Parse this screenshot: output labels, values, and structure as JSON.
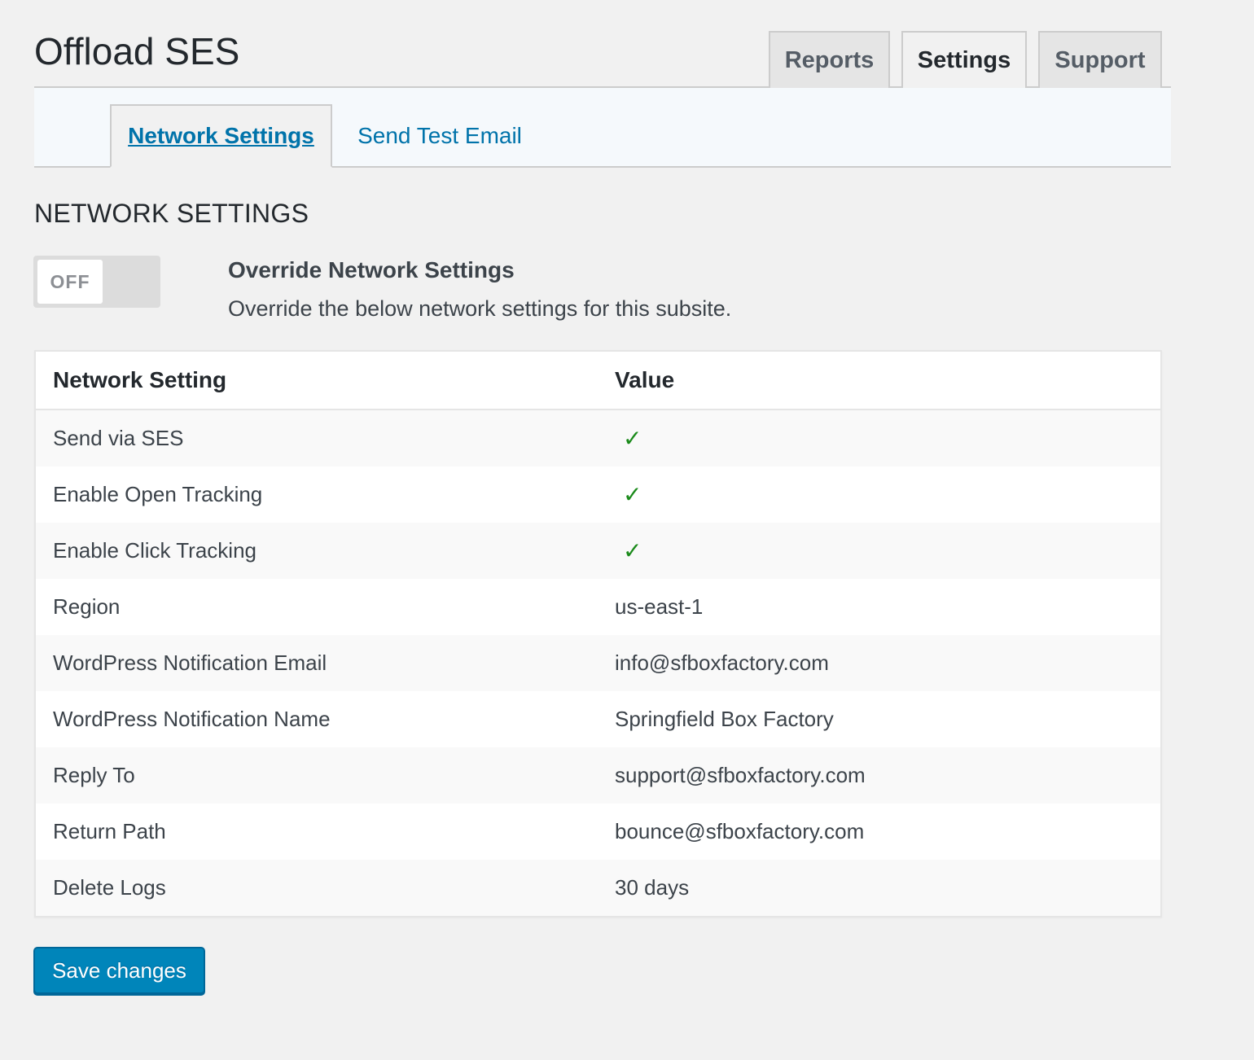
{
  "app": {
    "title": "Offload SES"
  },
  "main_tabs": [
    {
      "label": "Reports",
      "active": false
    },
    {
      "label": "Settings",
      "active": true
    },
    {
      "label": "Support",
      "active": false
    }
  ],
  "sub_tabs": [
    {
      "label": "Network Settings",
      "active": true
    },
    {
      "label": "Send Test Email",
      "active": false
    }
  ],
  "section": {
    "heading": "NETWORK SETTINGS"
  },
  "override": {
    "toggle_state": "OFF",
    "title": "Override Network Settings",
    "description": "Override the below network settings for this subsite."
  },
  "table": {
    "headers": [
      "Network Setting",
      "Value"
    ],
    "rows": [
      {
        "setting": "Send via SES",
        "value": "✓",
        "type": "check"
      },
      {
        "setting": "Enable Open Tracking",
        "value": "✓",
        "type": "check"
      },
      {
        "setting": "Enable Click Tracking",
        "value": "✓",
        "type": "check"
      },
      {
        "setting": "Region",
        "value": "us-east-1",
        "type": "text"
      },
      {
        "setting": "WordPress Notification Email",
        "value": "info@sfboxfactory.com",
        "type": "text"
      },
      {
        "setting": "WordPress Notification Name",
        "value": "Springfield Box Factory",
        "type": "text"
      },
      {
        "setting": "Reply To",
        "value": "support@sfboxfactory.com",
        "type": "text"
      },
      {
        "setting": "Return Path",
        "value": "bounce@sfboxfactory.com",
        "type": "text"
      },
      {
        "setting": "Delete Logs",
        "value": "30 days",
        "type": "text"
      }
    ]
  },
  "actions": {
    "save_label": "Save changes"
  },
  "colors": {
    "accent": "#0073aa",
    "button": "#0085ba",
    "check": "#1a8a1a",
    "background": "#f1f1f1"
  }
}
